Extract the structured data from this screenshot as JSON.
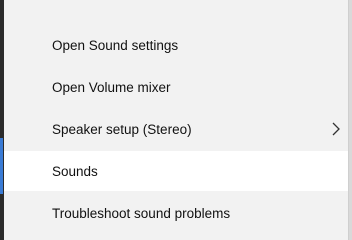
{
  "menu": {
    "items": [
      {
        "label": "Open Sound settings"
      },
      {
        "label": "Open Volume mixer"
      },
      {
        "label": "Speaker setup (Stereo)",
        "submenu_icon": "chevron-right-icon"
      },
      {
        "label": "Sounds",
        "highlighted": true
      },
      {
        "label": "Troubleshoot sound problems"
      }
    ]
  },
  "colors": {
    "menu_background": "#f2f2f2",
    "highlight_background": "#ffffff",
    "text": "#111111",
    "accent": "#3a7bd5"
  }
}
